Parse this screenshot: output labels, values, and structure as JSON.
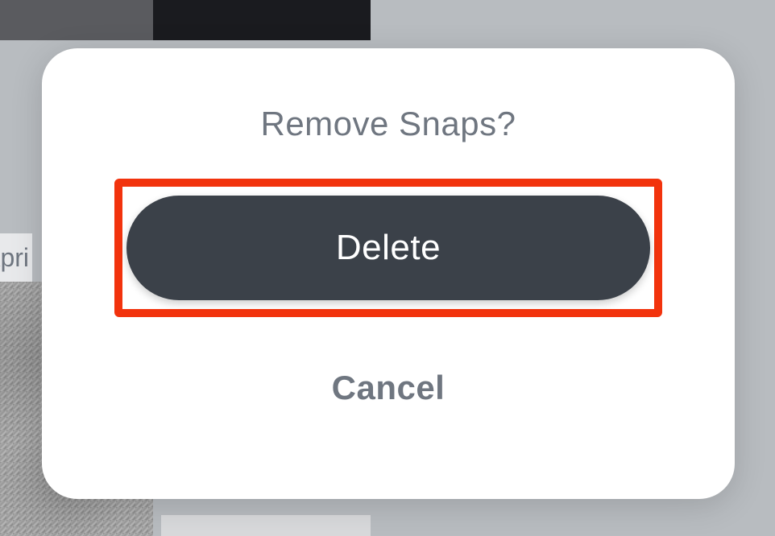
{
  "background": {
    "date_label": "Apri"
  },
  "modal": {
    "title": "Remove Snaps?",
    "delete_label": "Delete",
    "cancel_label": "Cancel"
  },
  "colors": {
    "highlight_border": "#f2330d",
    "button_bg": "#3b4149",
    "text_muted": "#6f7680"
  }
}
